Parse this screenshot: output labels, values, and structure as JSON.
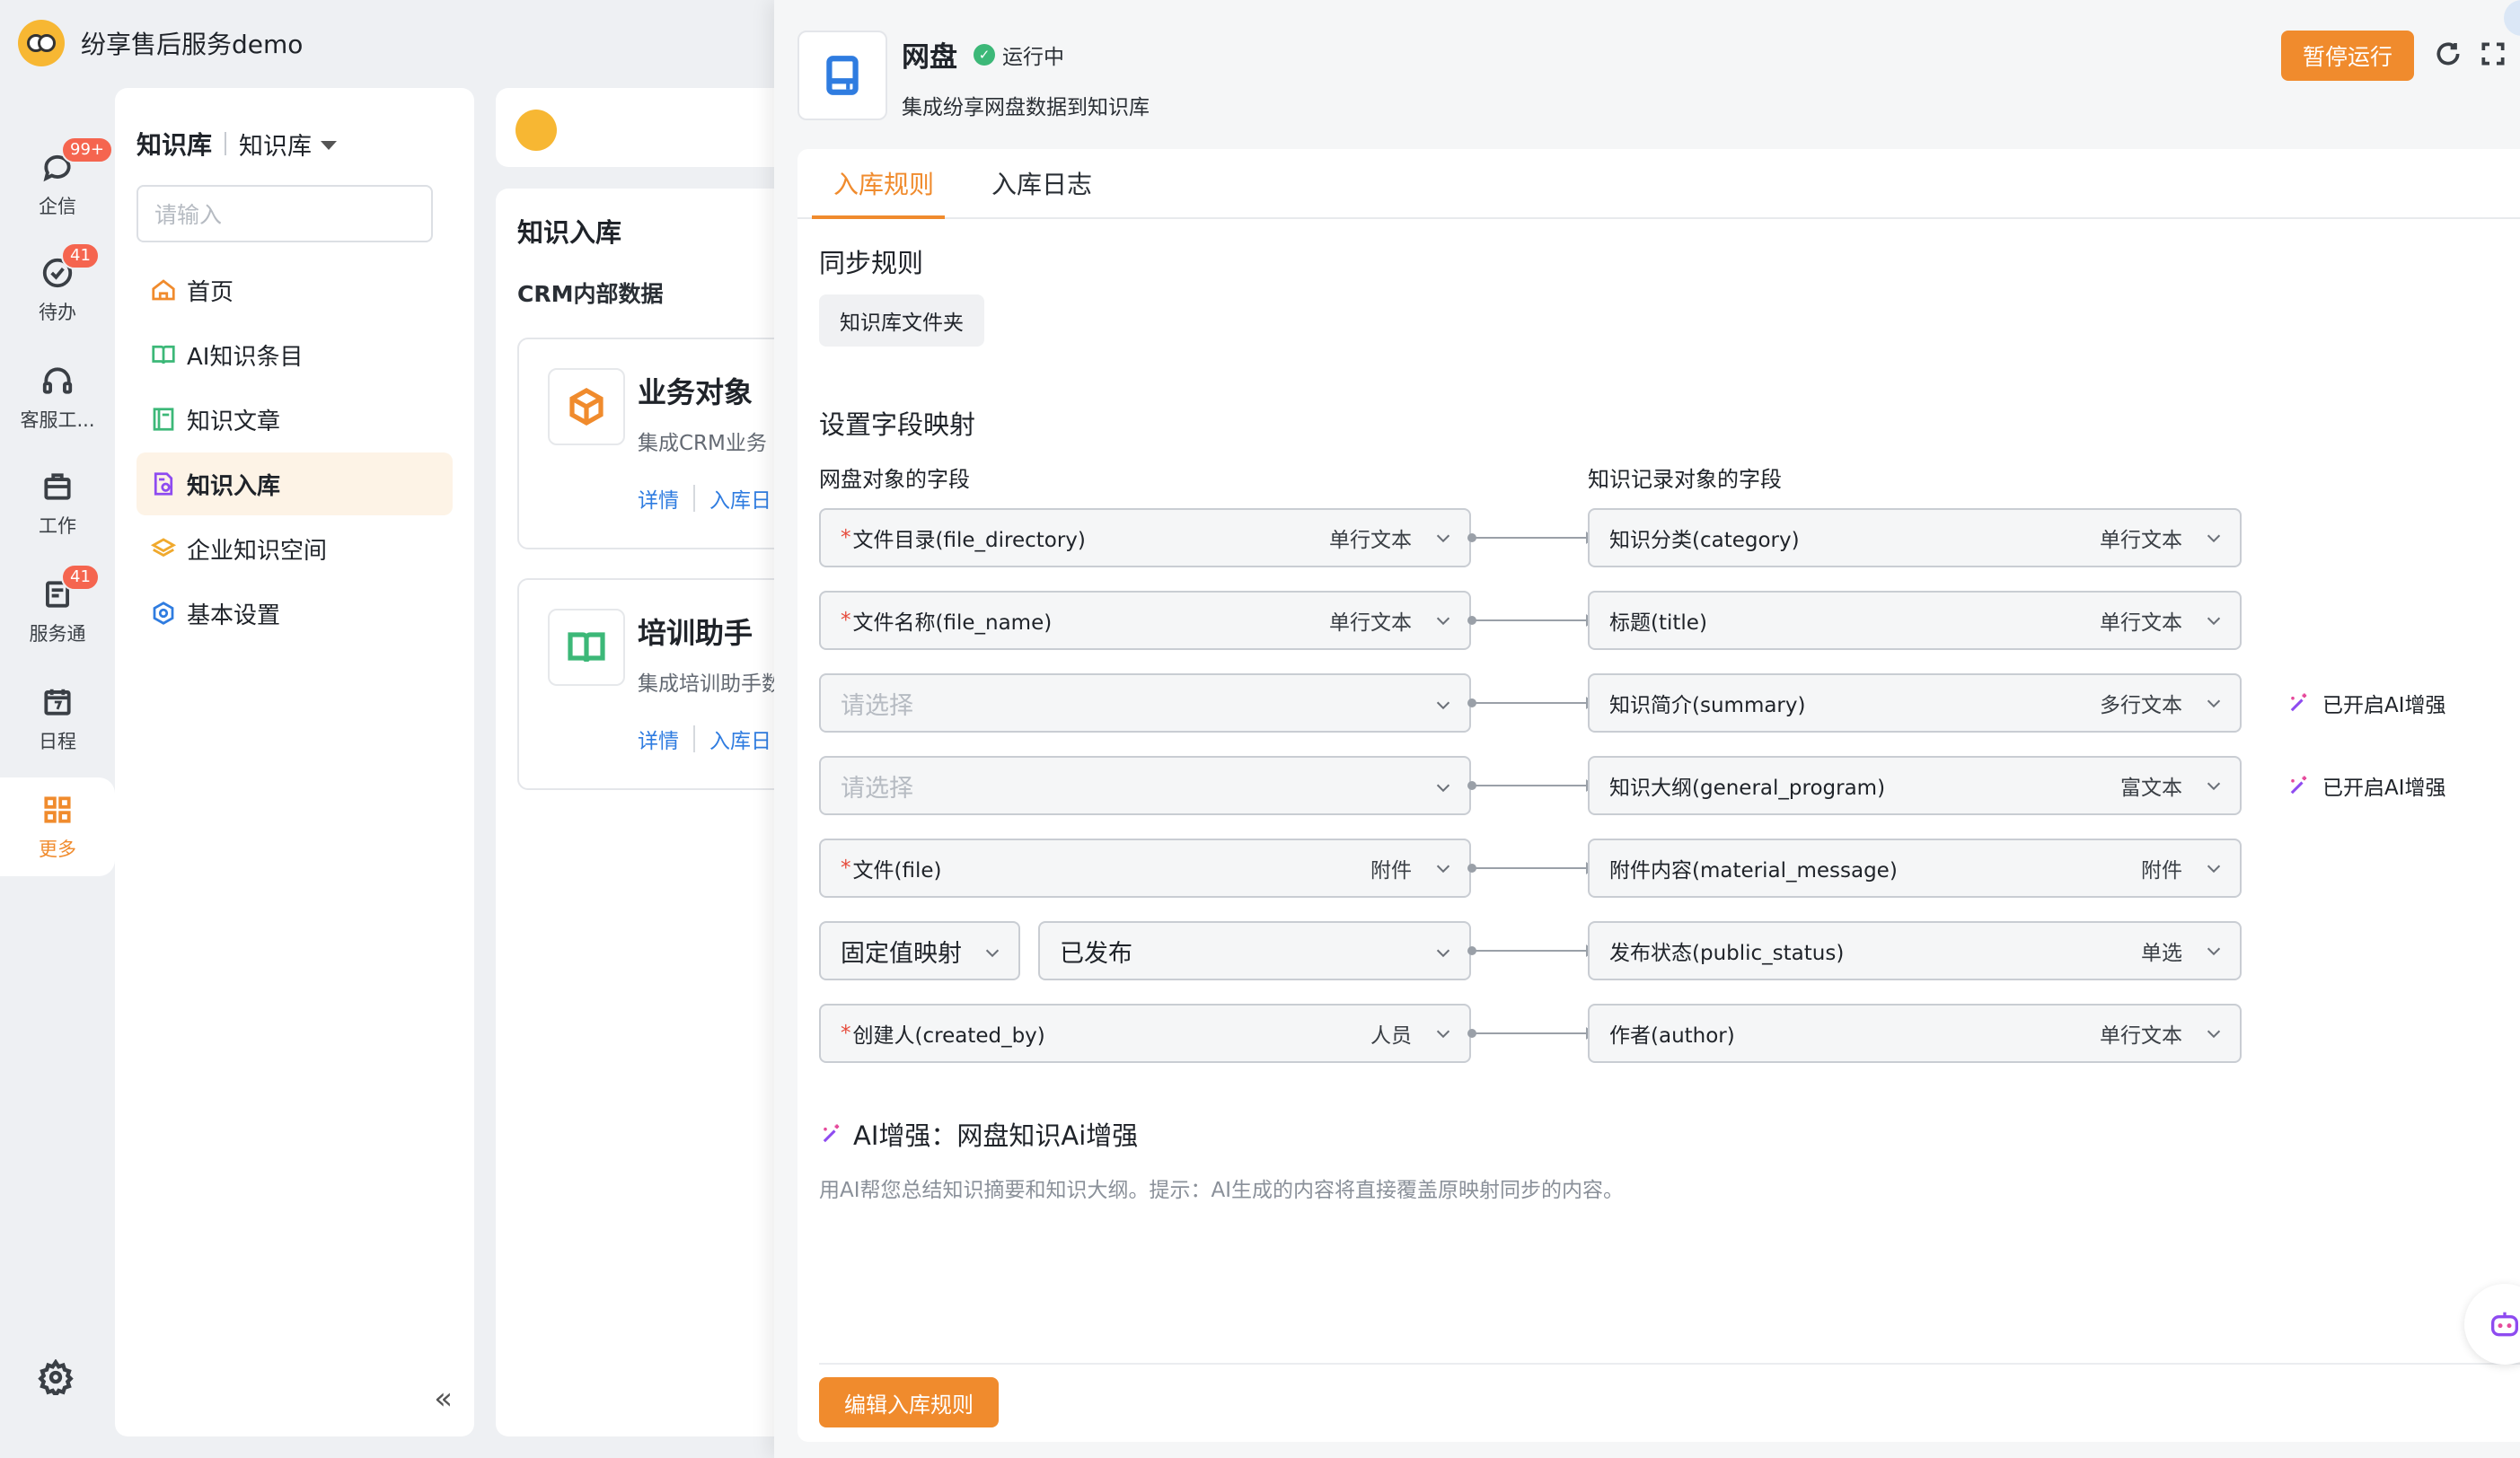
{
  "app": {
    "title": "纷享售后服务demo"
  },
  "rail": {
    "items": [
      {
        "label": "企信",
        "badge": "99+"
      },
      {
        "label": "待办",
        "badge": "41"
      },
      {
        "label": "客服工...",
        "badge": ""
      },
      {
        "label": "工作",
        "badge": ""
      },
      {
        "label": "服务通",
        "badge": "41"
      },
      {
        "label": "日程",
        "badge": ""
      },
      {
        "label": "更多",
        "badge": ""
      }
    ]
  },
  "kb": {
    "title": "知识库",
    "switcher": "知识库",
    "search_placeholder": "请输入",
    "nav": [
      {
        "label": "首页"
      },
      {
        "label": "AI知识条目"
      },
      {
        "label": "知识文章"
      },
      {
        "label": "知识入库"
      },
      {
        "label": "企业知识空间"
      },
      {
        "label": "基本设置"
      }
    ],
    "collapse": "«"
  },
  "mid": {
    "title": "知识入库",
    "section": "CRM内部数据",
    "cards": [
      {
        "title": "业务对象",
        "desc": "集成CRM业务",
        "detail": "详情",
        "log": "入库日"
      },
      {
        "title": "培训助手",
        "desc": "集成培训助手数",
        "detail": "详情",
        "log": "入库日"
      }
    ]
  },
  "drawer": {
    "title": "网盘",
    "status": "运行中",
    "desc": "集成纷享网盘数据到知识库",
    "pause": "暂停运行",
    "tabs": [
      "入库规则",
      "入库日志"
    ],
    "sync_title": "同步规则",
    "sync_chip": "知识库文件夹",
    "mapping_title": "设置字段映射",
    "left_head": "网盘对象的字段",
    "right_head": "知识记录对象的字段",
    "rows": [
      {
        "left_req": "*",
        "left_label": "文件目录(file_directory)",
        "left_type": "单行文本",
        "right_label": "知识分类(category)",
        "right_type": "单行文本",
        "ai": ""
      },
      {
        "left_req": "*",
        "left_label": "文件名称(file_name)",
        "left_type": "单行文本",
        "right_label": "标题(title)",
        "right_type": "单行文本",
        "ai": ""
      },
      {
        "left_req": "",
        "left_label": "请选择",
        "left_type": "",
        "right_label": "知识简介(summary)",
        "right_type": "多行文本",
        "ai": "已开启AI增强"
      },
      {
        "left_req": "",
        "left_label": "请选择",
        "left_type": "",
        "right_label": "知识大纲(general_program)",
        "right_type": "富文本",
        "ai": "已开启AI增强"
      },
      {
        "left_req": "*",
        "left_label": "文件(file)",
        "left_type": "附件",
        "right_label": "附件内容(material_message)",
        "right_type": "附件",
        "ai": ""
      },
      {
        "left_mode": "固定值映射",
        "left_value": "已发布",
        "right_label": "发布状态(public_status)",
        "right_type": "单选",
        "ai": ""
      },
      {
        "left_req": "*",
        "left_label": "创建人(created_by)",
        "left_type": "人员",
        "right_label": "作者(author)",
        "right_type": "单行文本",
        "ai": ""
      }
    ],
    "ai_title": "AI增强：网盘知识Ai增强",
    "ai_desc": "用AI帮您总结知识摘要和知识大纲。提示：AI生成的内容将直接覆盖原映射同步的内容。",
    "edit_button": "编辑入库规则"
  },
  "colors": {
    "accent": "#f08b2d",
    "link": "#2f7ce0",
    "success": "#3cb878",
    "danger": "#e64b3c",
    "ai": "#8e4bf0"
  }
}
